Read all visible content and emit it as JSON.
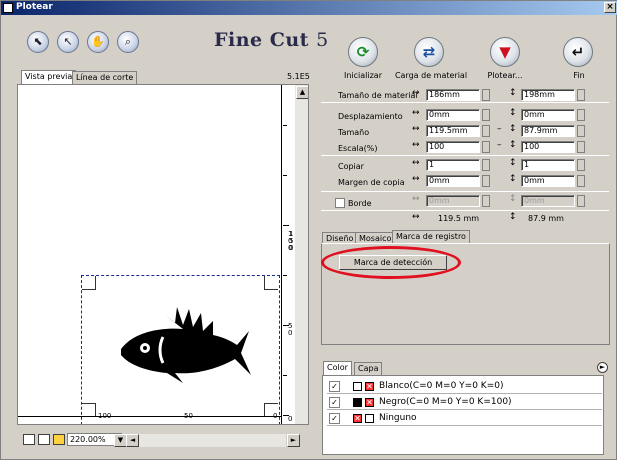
{
  "window": {
    "title": "Plotear",
    "close": "×"
  },
  "toolbar": {
    "logo_main": "Fine Cut ",
    "logo_ver": "5",
    "tool_icons": [
      "select-icon",
      "pointer-icon",
      "hand-icon",
      "zoom-icon"
    ]
  },
  "actions": [
    {
      "label": "Inicializar",
      "icon": "⟳",
      "color": "#1a8c2a"
    },
    {
      "label": "Carga de material",
      "icon": "⇄",
      "color": "#1a50a0"
    },
    {
      "label": "Plotear...",
      "icon": "▼",
      "color": "#cc1020"
    },
    {
      "label": "Fin",
      "icon": "↵",
      "color": "#111111"
    }
  ],
  "preview": {
    "tabs": [
      "Vista previa",
      "Línea de corte"
    ],
    "version": "5.1E5",
    "ruler_v": [
      "150",
      "100",
      "50",
      "0"
    ],
    "ruler_h": [
      "100",
      "50",
      "0"
    ],
    "zoom": "220.00%"
  },
  "settings": {
    "tamano_material": {
      "label": "Tamaño de material",
      "w": "186mm",
      "h": "198mm"
    },
    "desplazamiento": {
      "label": "Desplazamiento",
      "w": "0mm",
      "h": "0mm"
    },
    "tamano": {
      "label": "Tamaño",
      "w": "119.5mm",
      "h": "87.9mm"
    },
    "escala": {
      "label": "Escala(%)",
      "w": "100",
      "h": "100"
    },
    "copiar": {
      "label": "Copiar",
      "w": "1",
      "h": "1"
    },
    "margen": {
      "label": "Margen de copia",
      "w": "0mm",
      "h": "0mm"
    },
    "borde": {
      "label": "Borde",
      "w": "0mm",
      "h": "0mm"
    },
    "summary_w": "119.5 mm",
    "summary_h": "87.9 mm"
  },
  "mid_tabs": [
    "Diseño",
    "Mosaico",
    "Marca de registro"
  ],
  "marca_button": "Marca de detección",
  "color_tabs": [
    "Color",
    "Capa"
  ],
  "colors": [
    {
      "label": "Blanco(C=0 M=0 Y=0 K=0)",
      "swatch": "#ffffff"
    },
    {
      "label": "Negro(C=0 M=0 Y=0 K=100)",
      "swatch": "#000000"
    },
    {
      "label": "Ninguno",
      "swatch": "#ffffff"
    }
  ],
  "symbols": {
    "horiz": "↔",
    "vert": "↕",
    "dash": "–",
    "check": "✓",
    "x": "✕",
    "up": "▲",
    "down": "▼",
    "left": "◄",
    "right": "►"
  }
}
